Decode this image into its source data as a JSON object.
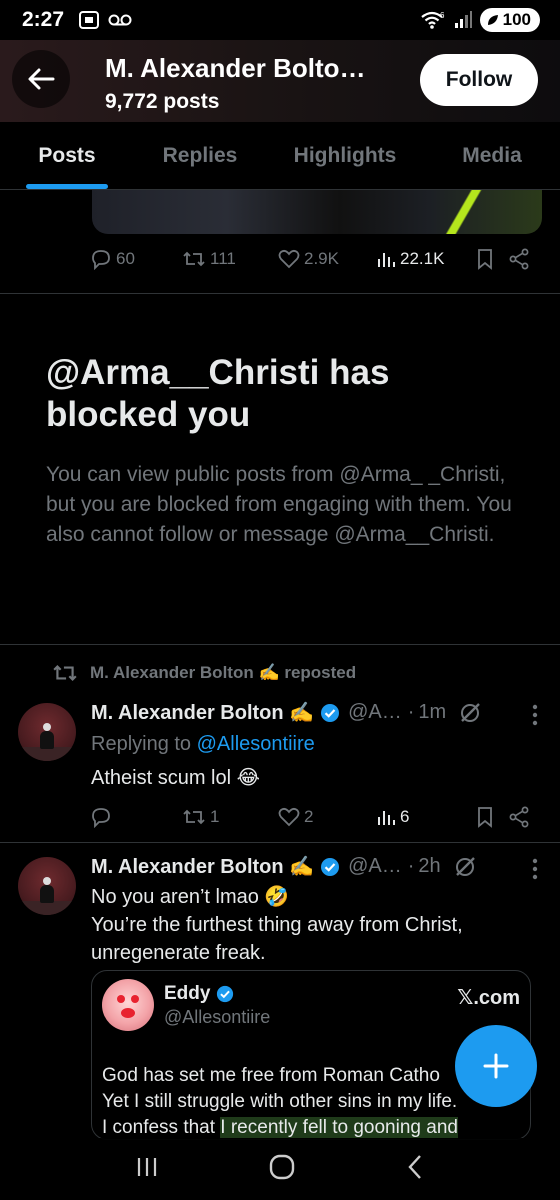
{
  "status_bar": {
    "time": "2:27",
    "battery": "100"
  },
  "header": {
    "name": "M. Alexander Bolto…",
    "posts_count": "9,772 posts",
    "follow_label": "Follow"
  },
  "tabs": [
    {
      "label": "Posts",
      "active": true
    },
    {
      "label": "Replies",
      "active": false
    },
    {
      "label": "Highlights",
      "active": false
    },
    {
      "label": "Media",
      "active": false
    }
  ],
  "prev_post_actions": {
    "replies": "60",
    "reposts": "111",
    "likes": "2.9K",
    "views": "22.1K"
  },
  "blocked": {
    "title": "@Arma__Christi has blocked you",
    "body": "You can view public posts from @Arma_ _Christi, but you are blocked from engaging with them. You also cannot follow or message @Arma__Christi."
  },
  "post1": {
    "repost_label": "M. Alexander Bolton ✍️ reposted",
    "name": "M. Alexander Bolton ✍️",
    "handle": "@A…",
    "time": "1m",
    "replying_prefix": "Replying to",
    "replying_handle": "@Allesontiire",
    "text": "Atheist scum lol 😂",
    "actions": {
      "replies": "",
      "reposts": "1",
      "likes": "2",
      "views": "6"
    }
  },
  "post2": {
    "name": "M. Alexander Bolton ✍️",
    "handle": "@A…",
    "time": "2h",
    "text_line1": "No you aren’t lmao 🤣",
    "text_line2": "You’re the furthest thing away from Christ, unregenerate freak.",
    "quote": {
      "name": "Eddy",
      "handle": "@Allesontiire",
      "source": "𝕏.com",
      "line1": "God has set me free from Roman Catho",
      "line2": "Yet I still struggle with other sins in my life.",
      "line3a": "I confess that ",
      "line3b": "I recently fell to gooning and"
    }
  },
  "colors": {
    "accent": "#1d9bf0",
    "muted": "#71767b",
    "text": "#e7e9ea",
    "border": "#2f3336"
  },
  "icons": [
    "back-arrow-icon",
    "reply-icon",
    "repost-icon",
    "like-icon",
    "views-icon",
    "bookmark-icon",
    "share-icon",
    "verified-icon",
    "grok-icon",
    "more-icon",
    "compose-icon"
  ]
}
